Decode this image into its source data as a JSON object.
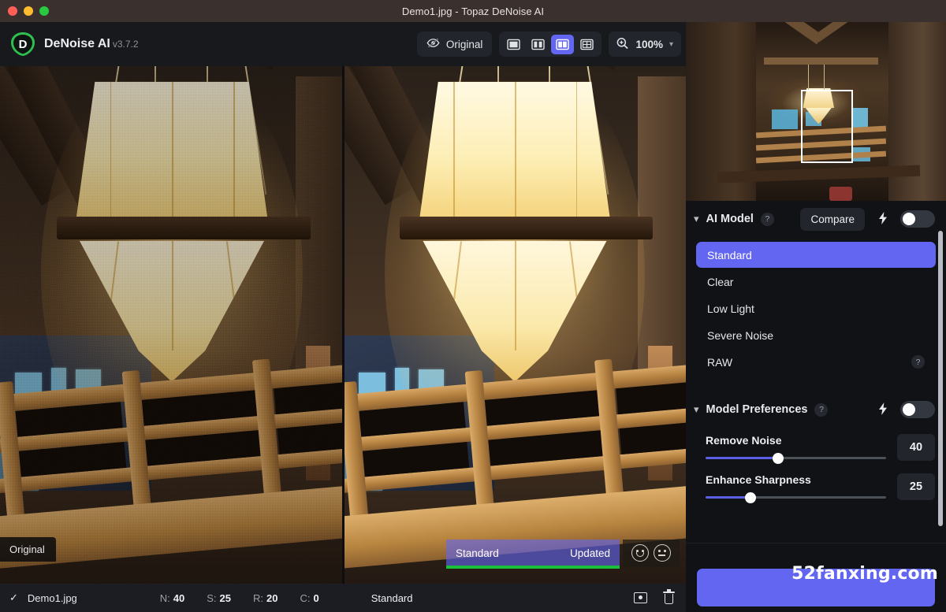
{
  "window": {
    "title": "Demo1.jpg - Topaz DeNoise AI",
    "controls": {
      "close": "close-button",
      "minimize": "minimize-button",
      "zoom": "maximize-button"
    }
  },
  "toolbar": {
    "brand_name": "DeNoise AI",
    "brand_version": "v3.7.2",
    "original_button": "Original",
    "view_modes": [
      {
        "name": "single-view",
        "active": false
      },
      {
        "name": "split-view",
        "active": false
      },
      {
        "name": "side-by-side-view",
        "active": true
      },
      {
        "name": "grid-view",
        "active": false
      }
    ],
    "zoom_level": "100%",
    "zoom_caret": "⌄"
  },
  "canvas": {
    "left_label": "Original",
    "preview_model": "Standard",
    "preview_status": "Updated",
    "feedback": [
      "smiley-face",
      "neutral-face"
    ]
  },
  "navigator": {
    "viewport_label": "viewport-rectangle"
  },
  "panel": {
    "ai_model": {
      "title": "AI Model",
      "help": "?",
      "compare_label": "Compare",
      "auto_bolt": "⚡",
      "toggle_on": false,
      "models": [
        {
          "label": "Standard",
          "selected": true,
          "help": ""
        },
        {
          "label": "Clear",
          "selected": false,
          "help": ""
        },
        {
          "label": "Low Light",
          "selected": false,
          "help": ""
        },
        {
          "label": "Severe Noise",
          "selected": false,
          "help": ""
        },
        {
          "label": "RAW",
          "selected": false,
          "help": "?"
        }
      ]
    },
    "model_preferences": {
      "title": "Model Preferences",
      "help": "?",
      "auto_bolt": "⚡",
      "toggle_on": false,
      "sliders": [
        {
          "label": "Remove Noise",
          "value": "40",
          "percent": 40
        },
        {
          "label": "Enhance Sharpness",
          "value": "25",
          "percent": 25
        }
      ]
    },
    "apply_button": "",
    "watermark": "52fanxing.com"
  },
  "statusbar": {
    "check": "✓",
    "filename": "Demo1.jpg",
    "stats": [
      {
        "key": "N:",
        "value": "40"
      },
      {
        "key": "S:",
        "value": "25"
      },
      {
        "key": "R:",
        "value": "20"
      },
      {
        "key": "C:",
        "value": "0"
      }
    ],
    "model": "Standard",
    "icons": [
      "preview-icon",
      "delete-icon"
    ]
  },
  "colors": {
    "accent": "#6366f1",
    "brand_green": "#2fbf4f",
    "progress_green": "#1bbf3a",
    "titlebar": "#3a312e",
    "panel_bg": "#111216"
  }
}
